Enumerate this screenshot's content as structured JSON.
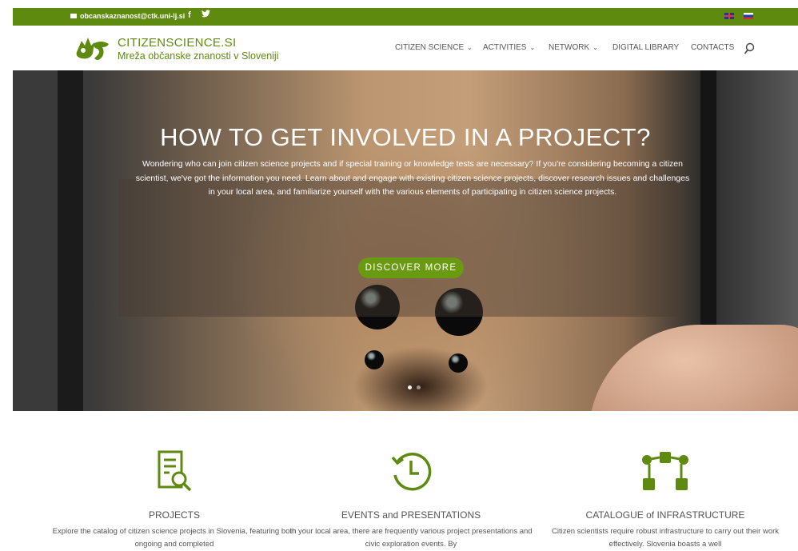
{
  "topbar": {
    "email": "obcanskaznanost@ctk.uni-lj.si",
    "facebook_icon": "f",
    "twitter_icon": "bird"
  },
  "header": {
    "site_name": "CITIZENSCIENCE.SI",
    "site_subtitle": "Mreža občanske znanosti v Sloveniji",
    "nav": [
      {
        "label": "CITIZEN SCIENCE",
        "dropdown": true
      },
      {
        "label": "ACTIVITIES",
        "dropdown": true
      },
      {
        "label": "NETWORK",
        "dropdown": true
      },
      {
        "label": "DIGITAL LIBRARY",
        "dropdown": false
      },
      {
        "label": "CONTACTS",
        "dropdown": false
      }
    ],
    "chevron": "⌄"
  },
  "hero": {
    "title": "HOW TO GET INVOLVED IN A PROJECT?",
    "text": "Wondering who can join citizen science projects and if special training or knowledge tests are necessary? If you're considering becoming a citizen scientist, we've got the information you need. Learn about and engage with existing citizen science projects, discover research issues and challenges in your local area, and familiarize yourself with the various elements of participating in citizen science projects.",
    "button": "DISCOVER MORE"
  },
  "features": [
    {
      "icon": "document-search-icon",
      "title": "PROJECTS",
      "text": "Explore the catalog of citizen science projects in Slovenia, featuring both ongoing and completed"
    },
    {
      "icon": "history-clock-icon",
      "title": "EVENTS and PRESENTATIONS",
      "text": "In your local area, there are frequently various project presentations and civic exploration events. By"
    },
    {
      "icon": "network-nodes-icon",
      "title": "CATALOGUE of INFRASTRUCTURE",
      "text": "Citizen scientists require robust infrastructure to carry out their work effectively. Slovenia boasts a well"
    }
  ],
  "colors": {
    "brand_green": "#5e8a10",
    "button_green": "#6a9a12"
  }
}
